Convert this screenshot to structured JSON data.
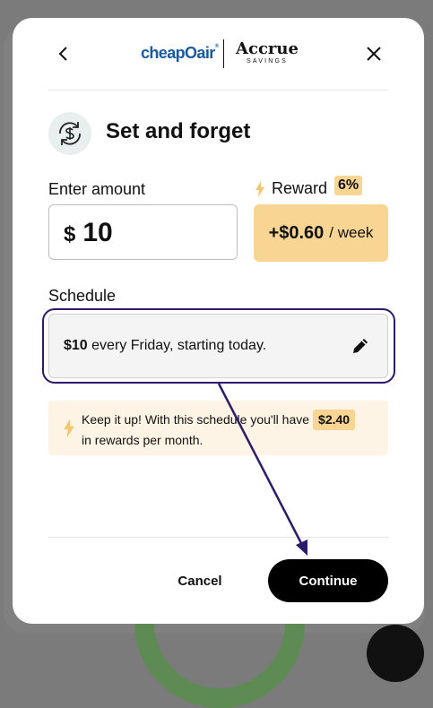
{
  "header": {
    "partner_logo": "cheapOair",
    "partner_logo_reg": "®",
    "brand_logo": "Accrue",
    "brand_logo_sub": "SAVINGS"
  },
  "title": "Set and forget",
  "amount": {
    "label": "Enter amount",
    "currency": "$",
    "value": "10"
  },
  "reward": {
    "label": "Reward",
    "percent": "6%",
    "value": "+$0.60",
    "unit": "/ week"
  },
  "schedule": {
    "label": "Schedule",
    "amount": "$10",
    "text": "every Friday, starting today."
  },
  "tip": {
    "text_before": "Keep it up! With this schedule you'll have",
    "amount": "$2.40",
    "text_after": "in rewards per month."
  },
  "actions": {
    "cancel_label": "Cancel",
    "continue_label": "Continue"
  },
  "colors": {
    "accent_yellow": "#f8d592",
    "highlight_outline": "#2e1a6b",
    "brand_blue": "#1a5aa0"
  },
  "icons": {
    "back": "chevron-left-icon",
    "close": "close-icon",
    "title": "recurring-dollar-icon",
    "reward": "lightning-bolt-icon",
    "edit": "pencil-icon"
  }
}
